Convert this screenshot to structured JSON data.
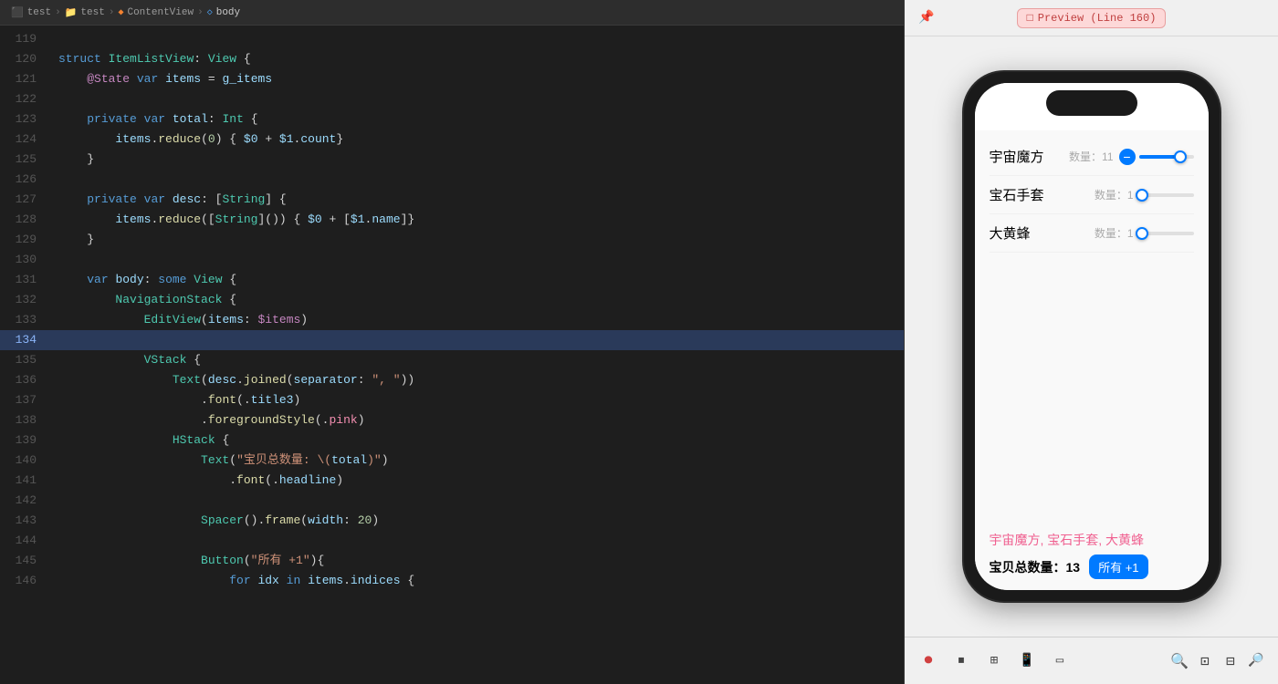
{
  "breadcrumb": {
    "items": [
      {
        "label": "test",
        "icon": "folder-icon",
        "active": false
      },
      {
        "label": "test",
        "icon": "folder-icon",
        "active": false
      },
      {
        "label": "ContentView",
        "icon": "swift-icon",
        "active": false
      },
      {
        "label": "body",
        "icon": "swift-icon",
        "active": true
      }
    ],
    "separators": [
      ">",
      ">",
      ">"
    ]
  },
  "preview": {
    "pin_icon": "📌",
    "title": "Preview (Line 160)",
    "phone": {
      "items": [
        {
          "name": "宇宙魔方",
          "count_label": "数量：11",
          "fill_percent": 85
        },
        {
          "name": "宝石手套",
          "count_label": "数量：1",
          "fill_percent": 5
        },
        {
          "name": "大黄蜂",
          "count_label": "数量：1",
          "fill_percent": 5
        }
      ],
      "desc_text": "宇宙魔方, 宝石手套, 大黄蜂",
      "total_label": "宝贝总数量：13",
      "button_label": "所有 +1"
    }
  },
  "toolbar": {
    "play_label": "▶",
    "stop_label": "■",
    "inspect_label": "⊞",
    "device_label": "📱",
    "orientation_label": "⟳",
    "zoom_minus": "−",
    "zoom_plus": "+",
    "zoom_fit": "⊡",
    "zoom_actual": "⊟"
  },
  "code": {
    "lines": [
      {
        "num": 119,
        "active": false,
        "tokens": []
      },
      {
        "num": 120,
        "active": false,
        "text": "struct ItemListView: View {"
      },
      {
        "num": 121,
        "active": false,
        "text": "    @State var items = g_items"
      },
      {
        "num": 122,
        "active": false,
        "text": ""
      },
      {
        "num": 123,
        "active": false,
        "text": "    private var total: Int {"
      },
      {
        "num": 124,
        "active": false,
        "text": "        items.reduce(0) { $0 + $1.count}"
      },
      {
        "num": 125,
        "active": false,
        "text": "    }"
      },
      {
        "num": 126,
        "active": false,
        "text": ""
      },
      {
        "num": 127,
        "active": false,
        "text": "    private var desc: [String] {"
      },
      {
        "num": 128,
        "active": false,
        "text": "        items.reduce([String]()) { $0 + [$1.name]}"
      },
      {
        "num": 129,
        "active": false,
        "text": "    }"
      },
      {
        "num": 130,
        "active": false,
        "text": ""
      },
      {
        "num": 131,
        "active": false,
        "text": "    var body: some View {"
      },
      {
        "num": 132,
        "active": false,
        "text": "        NavigationStack {"
      },
      {
        "num": 133,
        "active": false,
        "text": "            EditView(items: $items)"
      },
      {
        "num": 134,
        "active": true,
        "text": ""
      },
      {
        "num": 135,
        "active": false,
        "text": "            VStack {"
      },
      {
        "num": 136,
        "active": false,
        "text": "                Text(desc.joined(separator: \", \"))"
      },
      {
        "num": 137,
        "active": false,
        "text": "                    .font(.title3)"
      },
      {
        "num": 138,
        "active": false,
        "text": "                    .foregroundStyle(.pink)"
      },
      {
        "num": 139,
        "active": false,
        "text": "                HStack {"
      },
      {
        "num": 140,
        "active": false,
        "text": "                    Text(\"宝贝总数量: \\(total)\")"
      },
      {
        "num": 141,
        "active": false,
        "text": "                        .font(.headline)"
      },
      {
        "num": 142,
        "active": false,
        "text": ""
      },
      {
        "num": 143,
        "active": false,
        "text": "                    Spacer().frame(width: 20)"
      },
      {
        "num": 144,
        "active": false,
        "text": ""
      },
      {
        "num": 145,
        "active": false,
        "text": "                    Button(\"所有 +1\"){"
      },
      {
        "num": 146,
        "active": false,
        "text": "                        for idx in items.indices {"
      }
    ]
  }
}
